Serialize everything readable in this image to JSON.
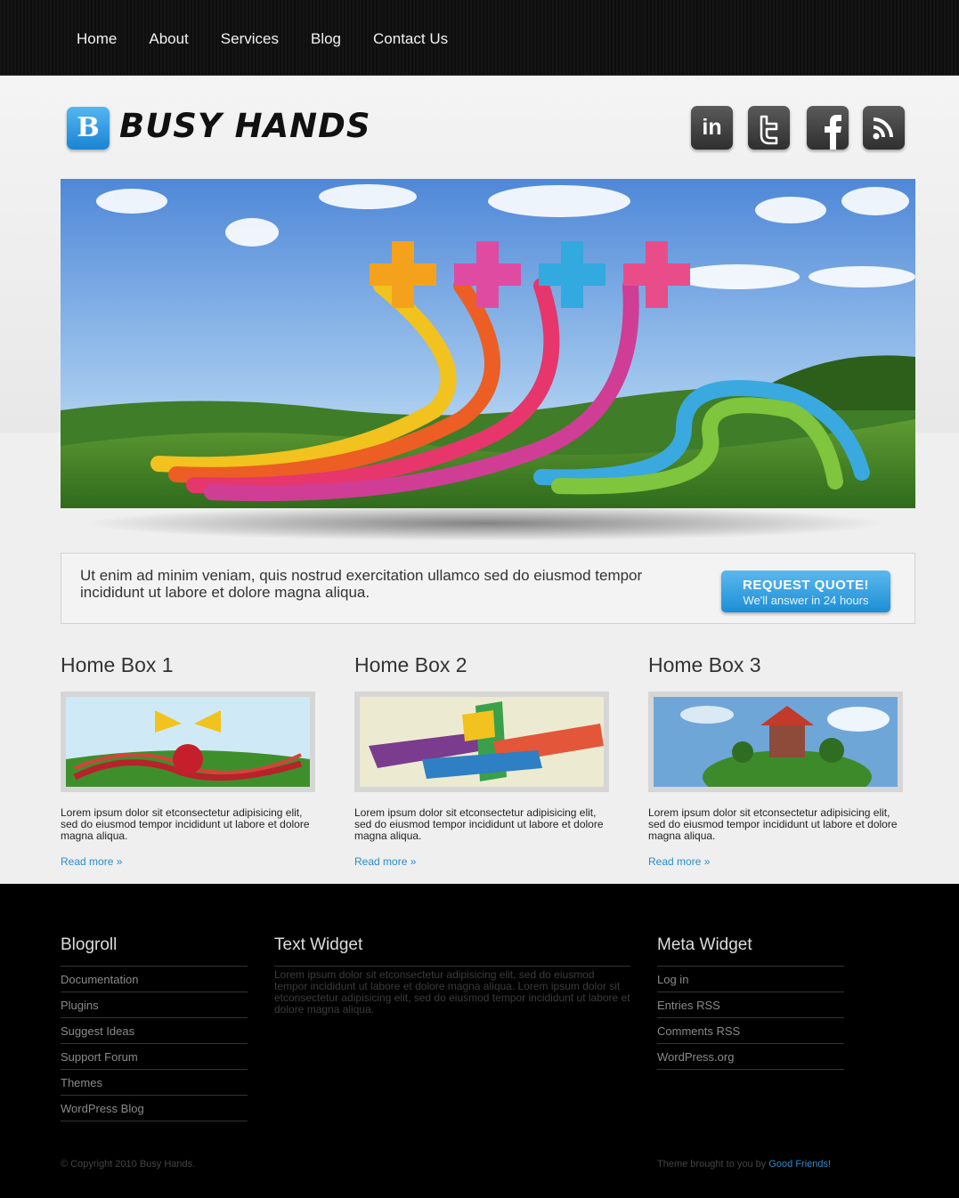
{
  "nav": {
    "items": [
      "Home",
      "About",
      "Services",
      "Blog",
      "Contact Us"
    ]
  },
  "logo": {
    "letter": "B",
    "text": "BUSY HANDS"
  },
  "social": [
    "linkedin-icon",
    "twitter-icon",
    "facebook-icon",
    "rss-icon"
  ],
  "social_labels": {
    "linkedin": "in"
  },
  "quote": {
    "text": "Ut enim ad minim veniam, quis nostrud exercitation ullamco sed do eiusmod tempor incididunt ut labore et dolore magna aliqua.",
    "button_title": "REQUEST QUOTE!",
    "button_sub": "We'll answer in 24 hours"
  },
  "boxes": [
    {
      "title": "Home Box 1",
      "text": "Lorem ipsum dolor sit etconsectetur adipisicing elit, sed do eiusmod tempor incididunt ut labore et dolore magna aliqua.",
      "link": "Read more »"
    },
    {
      "title": "Home Box 2",
      "text": "Lorem ipsum dolor sit etconsectetur adipisicing elit, sed do eiusmod tempor incididunt ut labore et dolore magna aliqua.",
      "link": "Read more »"
    },
    {
      "title": "Home Box 3",
      "text": "Lorem ipsum dolor sit etconsectetur adipisicing elit, sed do eiusmod tempor incididunt ut labore et dolore magna aliqua.",
      "link": "Read more »"
    }
  ],
  "footer": {
    "blogroll": {
      "title": "Blogroll",
      "items": [
        "Documentation",
        "Plugins",
        "Suggest Ideas",
        "Support Forum",
        "Themes",
        "WordPress Blog"
      ]
    },
    "text_widget": {
      "title": "Text Widget",
      "text": "Lorem ipsum dolor sit etconsectetur adipisicing elit, sed do eiusmod tempor incididunt ut labore et dolore magna aliqua. Lorem ipsum dolor sit etconsectetur adipisicing elit, sed do eiusmod tempor incididunt ut labore et dolore magna aliqua."
    },
    "meta": {
      "title": "Meta Widget",
      "items": [
        "Log in",
        "Entries RSS",
        "Comments RSS",
        "WordPress.org"
      ]
    },
    "copyright": "© Copyright 2010 Busy Hands.",
    "theme_prefix": "Theme brought to you by",
    "theme_link": "Good Friends!"
  },
  "colors": {
    "accent": "#2a8ccf",
    "footer_bg": "#000000",
    "button_top": "#5cb8ee",
    "button_bottom": "#1c8ed6"
  }
}
